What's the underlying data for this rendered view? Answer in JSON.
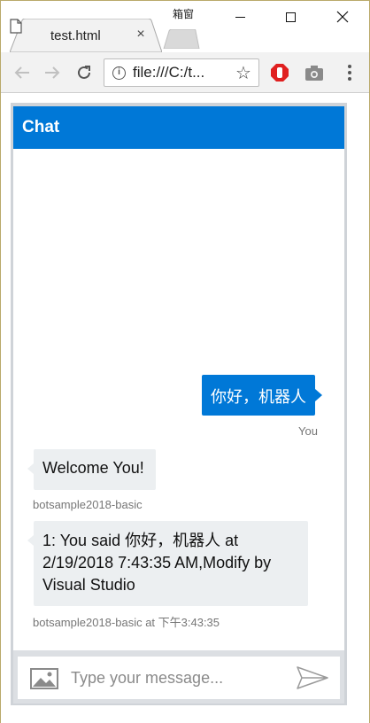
{
  "window": {
    "title": "箱窗"
  },
  "browser": {
    "tab_label": "test.html",
    "tab_close": "×",
    "url": "file:///C:/t...",
    "icons": [
      "back-icon",
      "forward-icon",
      "reload-icon",
      "info-icon",
      "star-icon",
      "stop-extension-icon",
      "camera-icon",
      "menu-icon"
    ]
  },
  "chat": {
    "header_title": "Chat",
    "accent_color": "#0078d7",
    "messages": [
      {
        "from": "user",
        "text": "你好，机器人",
        "meta": "You"
      },
      {
        "from": "bot",
        "text": "Welcome You!",
        "meta": "botsample2018-basic"
      },
      {
        "from": "bot",
        "text": "1: You said 你好，机器人 at 2/19/2018 7:43:35 AM,Modify by Visual Studio",
        "meta": "botsample2018-basic at 下午3:43:35"
      }
    ],
    "input_placeholder": "Type your message..."
  }
}
